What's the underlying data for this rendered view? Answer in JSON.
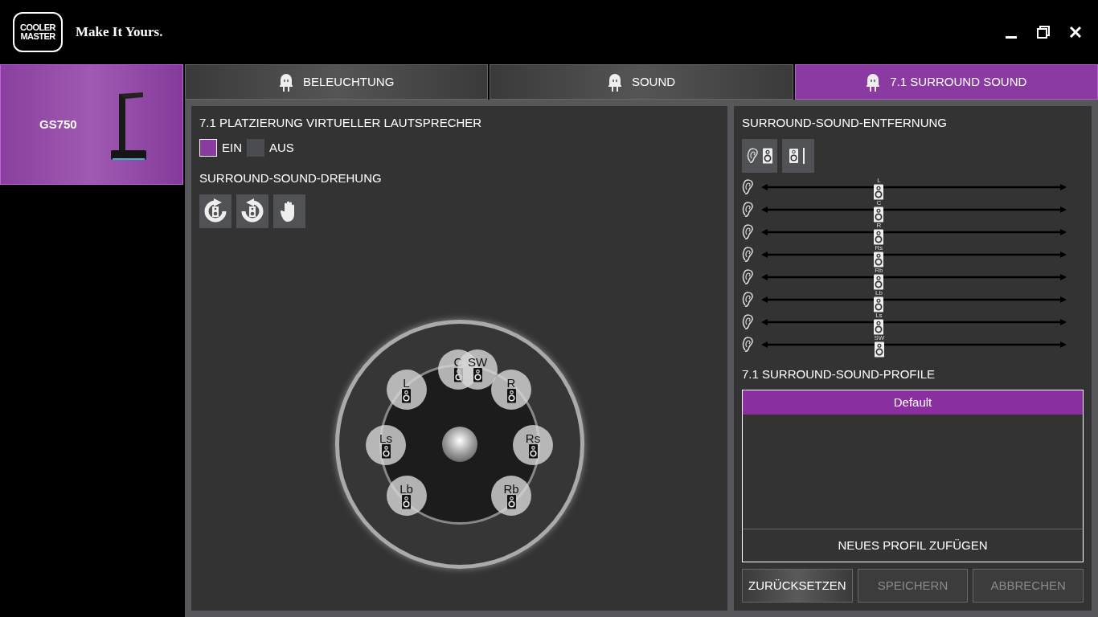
{
  "header": {
    "logo_top": "COOLER",
    "logo_bottom": "MASTER",
    "tagline": "Make It Yours."
  },
  "devices": [
    {
      "name": "GS750",
      "selected": true
    }
  ],
  "tabs": [
    {
      "label": "BELEUCHTUNG",
      "selected": false
    },
    {
      "label": "SOUND",
      "selected": false
    },
    {
      "label": "7.1 SURROUND SOUND",
      "selected": true
    }
  ],
  "placement": {
    "title": "7.1 PLATZIERUNG VIRTUELLER LAUTSPRECHER",
    "options": [
      {
        "label": "EIN",
        "selected": true
      },
      {
        "label": "AUS",
        "selected": false
      }
    ]
  },
  "rotation": {
    "title": "SURROUND-SOUND-DREHUNG",
    "buttons": [
      {
        "kind": "clockwise"
      },
      {
        "kind": "counterclockwise"
      },
      {
        "kind": "hand"
      }
    ]
  },
  "speakers": [
    {
      "label": "C"
    },
    {
      "label": "SW"
    },
    {
      "label": "L"
    },
    {
      "label": "R"
    },
    {
      "label": "Ls"
    },
    {
      "label": "Rs"
    },
    {
      "label": "Lb"
    },
    {
      "label": "Rb"
    }
  ],
  "distance": {
    "title": "SURROUND-SOUND-ENTFERNUNG",
    "modes": [
      {
        "kind": "ear-speaker"
      },
      {
        "kind": "speaker-wall"
      }
    ],
    "channels": [
      {
        "label": "L",
        "level": 0.38
      },
      {
        "label": "C",
        "level": 0.38
      },
      {
        "label": "R",
        "level": 0.38
      },
      {
        "label": "Rs",
        "level": 0.38
      },
      {
        "label": "Rb",
        "level": 0.38
      },
      {
        "label": "Lb",
        "level": 0.38
      },
      {
        "label": "Ls",
        "level": 0.38
      },
      {
        "label": "SW",
        "level": 0.38
      }
    ]
  },
  "profiles": {
    "title": "7.1 SURROUND-SOUND-PROFILE",
    "items": [
      {
        "name": "Default",
        "selected": true
      }
    ],
    "add_label": "NEUES PROFIL ZUFÜGEN"
  },
  "actions": [
    {
      "label": "ZURÜCKSETZEN",
      "disabled": false
    },
    {
      "label": "SPEICHERN",
      "disabled": true
    },
    {
      "label": "ABBRECHEN",
      "disabled": true
    }
  ]
}
